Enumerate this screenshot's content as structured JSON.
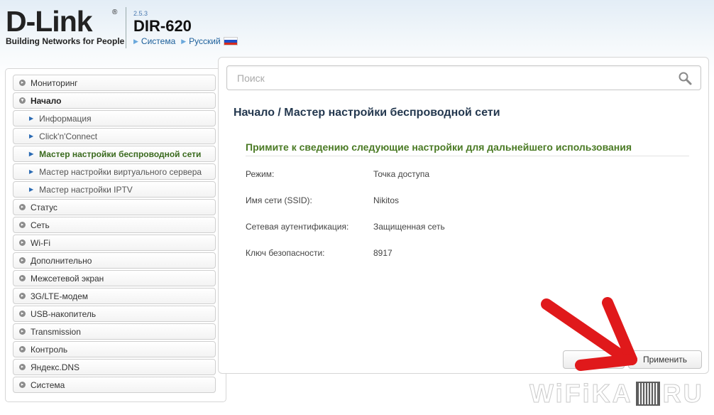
{
  "header": {
    "brand": "D-Link",
    "registered": "®",
    "tagline": "Building Networks for People",
    "firmware": "2.5.3",
    "model": "DIR-620",
    "system_link": "Система",
    "language_link": "Русский",
    "flag_colors": [
      "#ffffff",
      "#1f4fc6",
      "#d52b1e"
    ]
  },
  "sidebar": {
    "items": [
      {
        "label": "Мониторинг",
        "icon": "chevron-right-icon"
      },
      {
        "label": "Начало",
        "icon": "chevron-down-icon",
        "open": true
      },
      {
        "label": "Информация",
        "sub": true
      },
      {
        "label": "Click'n'Connect",
        "sub": true
      },
      {
        "label": "Мастер настройки беспроводной сети",
        "sub": true,
        "active": true
      },
      {
        "label": "Мастер настройки виртуального сервера",
        "sub": true
      },
      {
        "label": "Мастер настройки IPTV",
        "sub": true
      },
      {
        "label": "Статус",
        "icon": "chevron-right-icon"
      },
      {
        "label": "Сеть",
        "icon": "chevron-right-icon"
      },
      {
        "label": "Wi-Fi",
        "icon": "chevron-right-icon"
      },
      {
        "label": "Дополнительно",
        "icon": "chevron-right-icon"
      },
      {
        "label": "Межсетевой экран",
        "icon": "chevron-right-icon"
      },
      {
        "label": "3G/LTE-модем",
        "icon": "chevron-right-icon"
      },
      {
        "label": "USB-накопитель",
        "icon": "chevron-right-icon"
      },
      {
        "label": "Transmission",
        "icon": "chevron-right-icon"
      },
      {
        "label": "Контроль",
        "icon": "chevron-right-icon"
      },
      {
        "label": "Яндекс.DNS",
        "icon": "chevron-right-icon"
      },
      {
        "label": "Система",
        "icon": "chevron-right-icon"
      }
    ]
  },
  "search": {
    "placeholder": "Поиск",
    "value": ""
  },
  "main": {
    "title": "Начало /  Мастер настройки беспроводной сети",
    "notice": "Примите к сведению следующие настройки для дальнейшего использования",
    "rows": [
      {
        "key": "Режим:",
        "value": "Точка доступа"
      },
      {
        "key": "Имя сети (SSID):",
        "value": "Nikitos"
      },
      {
        "key": "Сетевая аутентификация:",
        "value": "Защищенная сеть"
      },
      {
        "key": "Ключ безопасности:",
        "value": "8917"
      }
    ],
    "apply_label": "Применить",
    "back_label": ""
  },
  "watermark": {
    "left": "WiFi",
    "right": "RU",
    "middle": "KA"
  },
  "colors": {
    "accent_green": "#4a7a24",
    "title_blue": "#24384f",
    "arrow_red": "#e0191b"
  }
}
